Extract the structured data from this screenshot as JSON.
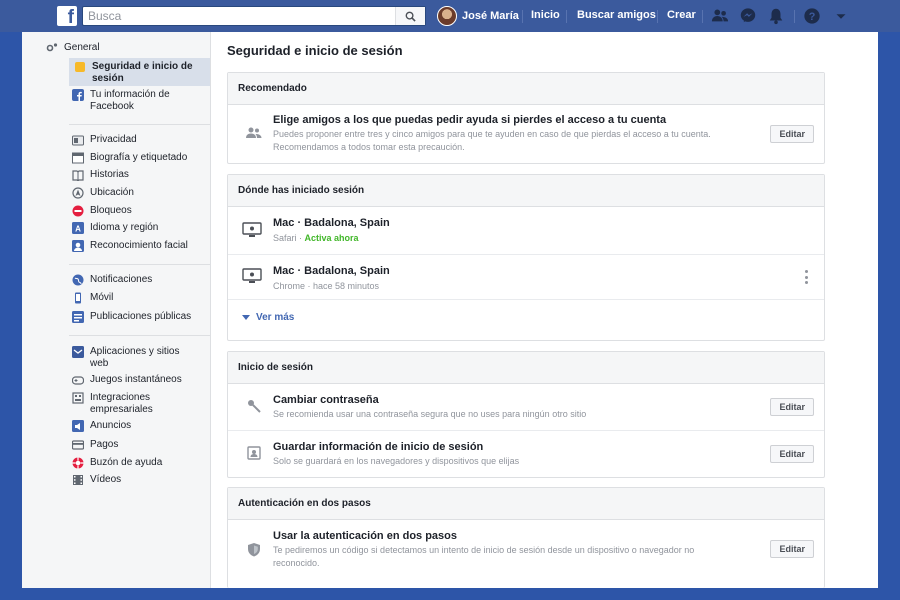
{
  "topbar": {
    "logo": "f",
    "search_placeholder": "Busca",
    "profile_name": "José María",
    "links": [
      "Inicio",
      "Buscar amigos",
      "Crear"
    ],
    "icons": [
      "friends-icon",
      "messenger-icon",
      "bell-icon",
      "help-icon",
      "dropdown-arrow-icon"
    ]
  },
  "sidebar": {
    "items": [
      {
        "label": "General",
        "icon": "gear-icon"
      },
      {
        "label": "Seguridad e inicio de sesión",
        "icon": "shield-icon",
        "active": true
      },
      {
        "label": "Tu información de Facebook",
        "icon": "facebook-icon"
      },
      {
        "label": "Privacidad",
        "icon": "privacy-icon"
      },
      {
        "label": "Biografía y etiquetado",
        "icon": "timeline-icon"
      },
      {
        "label": "Historias",
        "icon": "book-icon"
      },
      {
        "label": "Ubicación",
        "icon": "location-icon"
      },
      {
        "label": "Bloqueos",
        "icon": "block-icon"
      },
      {
        "label": "Idioma y región",
        "icon": "language-icon"
      },
      {
        "label": "Reconocimiento facial",
        "icon": "face-icon"
      },
      {
        "label": "Notificaciones",
        "icon": "globe-icon"
      },
      {
        "label": "Móvil",
        "icon": "mobile-icon"
      },
      {
        "label": "Publicaciones públicas",
        "icon": "rss-icon"
      },
      {
        "label": "Aplicaciones y sitios web",
        "icon": "apps-icon"
      },
      {
        "label": "Juegos instantáneos",
        "icon": "games-icon"
      },
      {
        "label": "Integraciones empresariales",
        "icon": "business-icon"
      },
      {
        "label": "Anuncios",
        "icon": "ads-icon"
      },
      {
        "label": "Pagos",
        "icon": "card-icon"
      },
      {
        "label": "Buzón de ayuda",
        "icon": "lifebuoy-icon"
      },
      {
        "label": "Vídeos",
        "icon": "video-icon"
      }
    ]
  },
  "main": {
    "title": "Seguridad e inicio de sesión",
    "recommended": {
      "header": "Recomendado",
      "title": "Elige amigos a los que puedas pedir ayuda si pierdes el acceso a tu cuenta",
      "sub1": "Puedes proponer entre tres y cinco amigos para que te ayuden en caso de que pierdas el acceso a tu cuenta.",
      "sub2": "Recomendamos a todos tomar esta precaución.",
      "button": "Editar"
    },
    "sessions": {
      "header": "Dónde has iniciado sesión",
      "items": [
        {
          "title": "Mac · Badalona, Spain",
          "browser": "Safari · ",
          "status": "Activa ahora"
        },
        {
          "title": "Mac · Badalona, Spain",
          "browser": "Chrome · hace 58 minutos",
          "status": ""
        }
      ],
      "see_more": "Ver más"
    },
    "login": {
      "header": "Inicio de sesión",
      "items": [
        {
          "title": "Cambiar contraseña",
          "sub": "Se recomienda usar una contraseña segura que no uses para ningún otro sitio",
          "button": "Editar"
        },
        {
          "title": "Guardar información de inicio de sesión",
          "sub": "Solo se guardará en los navegadores y dispositivos que elijas",
          "button": "Editar"
        }
      ]
    },
    "two_factor": {
      "header": "Autenticación en dos pasos",
      "title": "Usar la autenticación en dos pasos",
      "sub1": "Te pediremos un código si detectamos un intento de inicio de sesión desde un dispositivo o navegador no",
      "sub2": "reconocido.",
      "button": "Editar"
    }
  },
  "colors": {
    "topbar": "#3b5a9d",
    "frame": "#2d55a8",
    "link": "#4267b2",
    "active": "#42b72a"
  }
}
